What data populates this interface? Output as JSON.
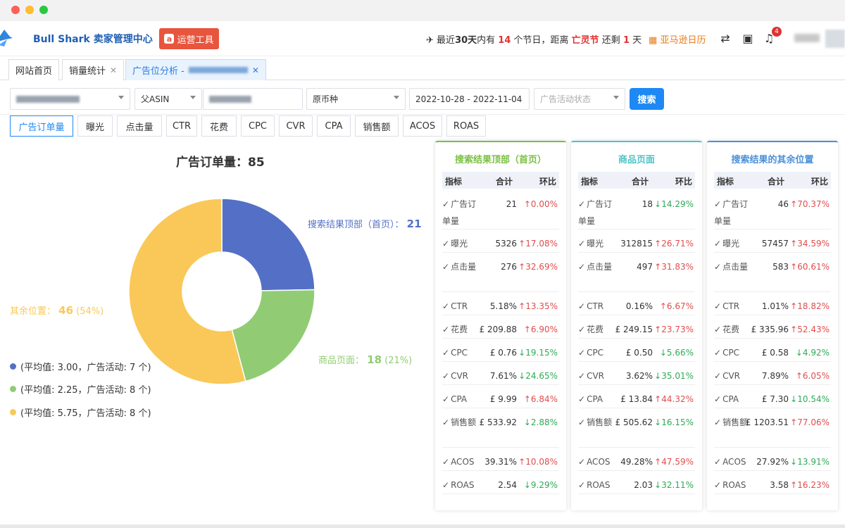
{
  "colors": {
    "blue": "#5470c6",
    "green": "#91cc75",
    "yellow": "#fac858",
    "accent": "#1e88f5",
    "red": "#e03232"
  },
  "header": {
    "brand": "Bull Shark 卖家管理中心",
    "tools_button": "运营工具",
    "holiday_prefix": "最近",
    "holiday_days": "30天",
    "holiday_mid1": "内有 ",
    "holiday_count": "14",
    "holiday_mid2": " 个节日，距离 ",
    "holiday_name": "亡灵节",
    "holiday_mid3": " 还剩 ",
    "holiday_left": "1",
    "holiday_suffix": " 天",
    "calendar_link": "亚马逊日历",
    "notification_count": "4"
  },
  "tabs": [
    {
      "label": "网站首页"
    },
    {
      "label": "销量统计"
    },
    {
      "label": "广告位分析 - "
    }
  ],
  "filters": {
    "asin_type": "父ASIN",
    "currency": "原币种",
    "date_range": "2022-10-28 - 2022-11-04",
    "campaign_status_placeholder": "广告活动状态",
    "search_button": "搜索"
  },
  "metric_tabs": [
    "广告订单量",
    "曝光",
    "点击量",
    "CTR",
    "花费",
    "CPC",
    "CVR",
    "CPA",
    "销售额",
    "ACOS",
    "ROAS"
  ],
  "chart_data": {
    "type": "pie",
    "title": "广告订单量：85",
    "slices": [
      {
        "name": "搜索结果顶部（首页）",
        "value": 21,
        "percent": null,
        "color": "#5470c6"
      },
      {
        "name": "商品页面",
        "value": 18,
        "percent": "(21%)",
        "color": "#91cc75"
      },
      {
        "name": "搜索结果的其余位置",
        "value": 46,
        "percent": "(54%)",
        "color": "#fac858"
      }
    ],
    "labels": {
      "top": "搜索结果顶部（首页）：",
      "top_value": "21",
      "product": "商品页面：",
      "product_value": "18",
      "product_pct": "(21%)",
      "rest": "其余位置：",
      "rest_value": "46",
      "rest_pct": "(54%)"
    },
    "legend": [
      "(平均值: 3.00，广告活动: 7 个)",
      "(平均值: 2.25，广告活动: 8 个)",
      "(平均值: 5.75，广告活动: 8 个)"
    ]
  },
  "table_headers": {
    "metric": "指标",
    "total": "合计",
    "change": "环比"
  },
  "panels": [
    {
      "title": "搜索结果顶部（首页）",
      "color": "#7bc043",
      "rows": [
        {
          "name": "广告订单量",
          "value": "21",
          "change": "0.00%",
          "dir": "up"
        },
        {
          "name": "曝光",
          "value": "5326",
          "change": "17.08%",
          "dir": "up"
        },
        {
          "name": "点击量",
          "value": "276",
          "change": "32.69%",
          "dir": "up"
        },
        {
          "name": "CTR",
          "value": "5.18%",
          "change": "13.35%",
          "dir": "up"
        },
        {
          "name": "花费",
          "value": "£ 209.88",
          "change": "6.90%",
          "dir": "up"
        },
        {
          "name": "CPC",
          "value": "£ 0.76",
          "change": "19.15%",
          "dir": "down"
        },
        {
          "name": "CVR",
          "value": "7.61%",
          "change": "24.65%",
          "dir": "down"
        },
        {
          "name": "CPA",
          "value": "£ 9.99",
          "change": "6.84%",
          "dir": "up"
        },
        {
          "name": "销售额",
          "value": "£ 533.92",
          "change": "2.88%",
          "dir": "down"
        },
        {
          "name": "ACOS",
          "value": "39.31%",
          "change": "10.08%",
          "dir": "up"
        },
        {
          "name": "ROAS",
          "value": "2.54",
          "change": "9.29%",
          "dir": "down"
        }
      ]
    },
    {
      "title": "商品页面",
      "color": "#4fc3c8",
      "rows": [
        {
          "name": "广告订单量",
          "value": "18",
          "change": "14.29%",
          "dir": "down"
        },
        {
          "name": "曝光",
          "value": "312815",
          "change": "26.71%",
          "dir": "up"
        },
        {
          "name": "点击量",
          "value": "497",
          "change": "31.83%",
          "dir": "up"
        },
        {
          "name": "CTR",
          "value": "0.16%",
          "change": "6.67%",
          "dir": "up"
        },
        {
          "name": "花费",
          "value": "£ 249.15",
          "change": "23.73%",
          "dir": "up"
        },
        {
          "name": "CPC",
          "value": "£ 0.50",
          "change": "5.66%",
          "dir": "down"
        },
        {
          "name": "CVR",
          "value": "3.62%",
          "change": "35.01%",
          "dir": "down"
        },
        {
          "name": "CPA",
          "value": "£ 13.84",
          "change": "44.32%",
          "dir": "up"
        },
        {
          "name": "销售额",
          "value": "£ 505.62",
          "change": "16.15%",
          "dir": "down"
        },
        {
          "name": "ACOS",
          "value": "49.28%",
          "change": "47.59%",
          "dir": "up"
        },
        {
          "name": "ROAS",
          "value": "2.03",
          "change": "32.11%",
          "dir": "down"
        }
      ]
    },
    {
      "title": "搜索结果的其余位置",
      "color": "#4a90d9",
      "rows": [
        {
          "name": "广告订单量",
          "value": "46",
          "change": "70.37%",
          "dir": "up"
        },
        {
          "name": "曝光",
          "value": "57457",
          "change": "34.59%",
          "dir": "up"
        },
        {
          "name": "点击量",
          "value": "583",
          "change": "60.61%",
          "dir": "up"
        },
        {
          "name": "CTR",
          "value": "1.01%",
          "change": "18.82%",
          "dir": "up"
        },
        {
          "name": "花费",
          "value": "£ 335.96",
          "change": "52.43%",
          "dir": "up"
        },
        {
          "name": "CPC",
          "value": "£ 0.58",
          "change": "4.92%",
          "dir": "down"
        },
        {
          "name": "CVR",
          "value": "7.89%",
          "change": "6.05%",
          "dir": "up"
        },
        {
          "name": "CPA",
          "value": "£ 7.30",
          "change": "10.54%",
          "dir": "down"
        },
        {
          "name": "销售额",
          "value": "£ 1203.51",
          "change": "77.06%",
          "dir": "up"
        },
        {
          "name": "ACOS",
          "value": "27.92%",
          "change": "13.91%",
          "dir": "down"
        },
        {
          "name": "ROAS",
          "value": "3.58",
          "change": "16.23%",
          "dir": "up"
        }
      ]
    }
  ]
}
